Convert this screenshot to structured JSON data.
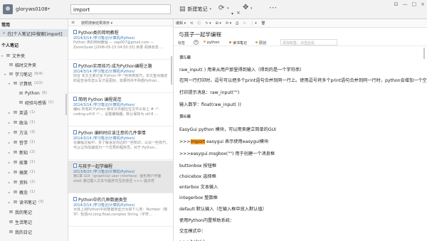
{
  "user": {
    "name": "gloryws0108",
    "caret": "▾"
  },
  "search": {
    "value": "import",
    "dropdown": "▾",
    "clear": "×"
  },
  "toolbar": {
    "new_note": "新建笔记",
    "new_note_caret": "▾",
    "sync_caret": "▾",
    "move_caret": "▾",
    "window_controls": [
      "⊡",
      "—",
      "□",
      "×"
    ]
  },
  "sidebar": {
    "common_header": "常用",
    "search_item": "在[个人笔记]中搜索[import]",
    "personal_header": "个人笔记",
    "items": [
      {
        "label": "文件夹",
        "count": "",
        "tri": "▾"
      },
      {
        "label": "临时文件夹",
        "count": "",
        "tri": ""
      },
      {
        "label": "学习笔记",
        "count": "(6/4)",
        "tri": "▾"
      },
      {
        "label": "计算机",
        "count": "(2/2)",
        "tri": "▾"
      },
      {
        "label": "Python",
        "count": "(6)",
        "tri": ""
      },
      {
        "label": "经验与感悟",
        "count": "(1)",
        "tri": ""
      },
      {
        "label": "英语",
        "count": "(1)",
        "tri": "▸"
      },
      {
        "label": "政治",
        "count": "(1)",
        "tri": "▸"
      },
      {
        "label": "方法",
        "count": "(3)",
        "tri": "▸"
      },
      {
        "label": "哲学",
        "count": "(1)",
        "tri": "▸"
      },
      {
        "label": "新知",
        "count": "(2)",
        "tri": "▸"
      },
      {
        "label": "故事",
        "count": "(1)",
        "tri": "▸"
      },
      {
        "label": "搞笑",
        "count": "(1)",
        "tri": "▸"
      },
      {
        "label": "资料",
        "count": "(2)",
        "tri": "▸"
      },
      {
        "label": "概念",
        "count": "(1)",
        "tri": "▸"
      },
      {
        "label": "读书笔记",
        "count": "(3)",
        "tri": "▸"
      },
      {
        "label": "我的笔记",
        "count": "",
        "tri": ""
      },
      {
        "label": "生活笔记",
        "count": "",
        "tri": ""
      },
      {
        "label": "我的日记",
        "count": "",
        "tri": ""
      }
    ]
  },
  "list": {
    "sort_label": "按照搜索结果排序 ▾",
    "notes": [
      {
        "title": "Python类的简明教程",
        "meta": "2014/3/14  /学习笔记/计算机/Python/",
        "snippet": "Python 类的简明教程 — zap007@gmail.com — ZoomQuiet [2006-05-15 04:55:33] 目录 阅读状态 ..."
      },
      {
        "title": "Python实用技巧:成为Python编程之路",
        "meta": "2014/3/14  /学习笔记/计算机/Python/",
        "snippet": "前言 本文主要记录 Python 中一些常用技巧，本文重点描述的是告诉你怎么写才是更好。如果你并不熟悉Python..."
      },
      {
        "title": "简明 Python 编程规范",
        "meta": "2014/3/14  /学习笔记/计算机/Python/",
        "snippet": "编码 所有的 Python 脚本文件都应在文件头标上 # -*- coding:utf-8 -*- 。设置编辑器，默认保存为 utf-8 ..."
      },
      {
        "title": "Python 编码时应该注意的几件事情",
        "meta": "2014/3/14  /学习笔记/计算机/Python/",
        "snippet": "在编程过程中，多了解语言周边的一些知识，以及一些技巧，可以让你加速成为一个优秀的程序员。对于 Python..."
      },
      {
        "title": "与孩子一起学编程",
        "meta": "2013/8/20  /学习笔记/计算机/Python/",
        "snippet": "第1章 GUI（graphical user interface）图形用户界面 shell 通过键入文本与程序交互的途径 >>> 提示符"
      },
      {
        "title": "Python中的几种数据类型",
        "meta": "2014/3/14  /学习笔记/计算机/Python/",
        "snippet": "大体上把Python中的数据类型分为如下几类：Number（数字）包括int,long,float,complex String（字符..."
      }
    ]
  },
  "editor": {
    "toolbar": [
      "编辑 ▾",
      "⟲",
      "ⓘ",
      "✎ ▾",
      "⊞ ▾",
      "✉ ▾",
      "⎙",
      "☆",
      "⋮ ▾",
      "🗑"
    ],
    "title": "与孩子一起学编程",
    "tag_label": "标签",
    "tag_add": "+",
    "tags": [
      {
        "label": "python",
        "color": "#f0ad2f"
      },
      {
        "label": "读书笔记",
        "color": "#e8772e"
      },
      {
        "label": "原创",
        "color": "#d9a441"
      }
    ],
    "tag_placeholder": "添加标签，点击此处",
    "lines": [
      {
        "pre": "第5章",
        "hl": "",
        "post": ""
      },
      {
        "pre": "raw_input( ) 用来从用户那里得到输入（得到的是一个字符串）",
        "hl": "",
        "post": ""
      },
      {
        "pre": "在同一行打印时，逗号可以把多个print语句合并到同一行上。使用逗号将多个print语句合并到同一行时，python会增加一个空格",
        "hl": "",
        "post": ""
      },
      {
        "pre": "打印提示消息：raw_input(\"\")",
        "hl": "",
        "post": ""
      },
      {
        "pre": "输入数字：float(raw_input( ))",
        "hl": "",
        "post": ""
      },
      {
        "pre": "第6章",
        "hl": "",
        "post": ""
      },
      {
        "pre": "EasyGui python 模块，可以用来建立简单的GUI",
        "hl": "",
        "post": ""
      },
      {
        "pre": ">>>",
        "hl": "import",
        "post": " easygui 表示使用easygui模块"
      },
      {
        "pre": ">>>easygui.msgbox(\"\") 用于创建一个消息框",
        "hl": "",
        "post": ""
      },
      {
        "pre": "buttonbox  按钮框",
        "hl": "",
        "post": ""
      },
      {
        "pre": "choicebox  选择框",
        "hl": "",
        "post": ""
      },
      {
        "pre": "enterbox   文本输入",
        "hl": "",
        "post": ""
      },
      {
        "pre": "integerbox 整数框",
        "hl": "",
        "post": ""
      },
      {
        "pre": "default     默认输入（在输入框中放入默认值）",
        "hl": "",
        "post": ""
      },
      {
        "pre": "使用Python内置帮助系统：",
        "hl": "",
        "post": ""
      },
      {
        "pre": "交互模式中：",
        "hl": "",
        "post": ""
      },
      {
        "pre": ">>>help( )",
        "hl": "",
        "post": ""
      }
    ]
  }
}
